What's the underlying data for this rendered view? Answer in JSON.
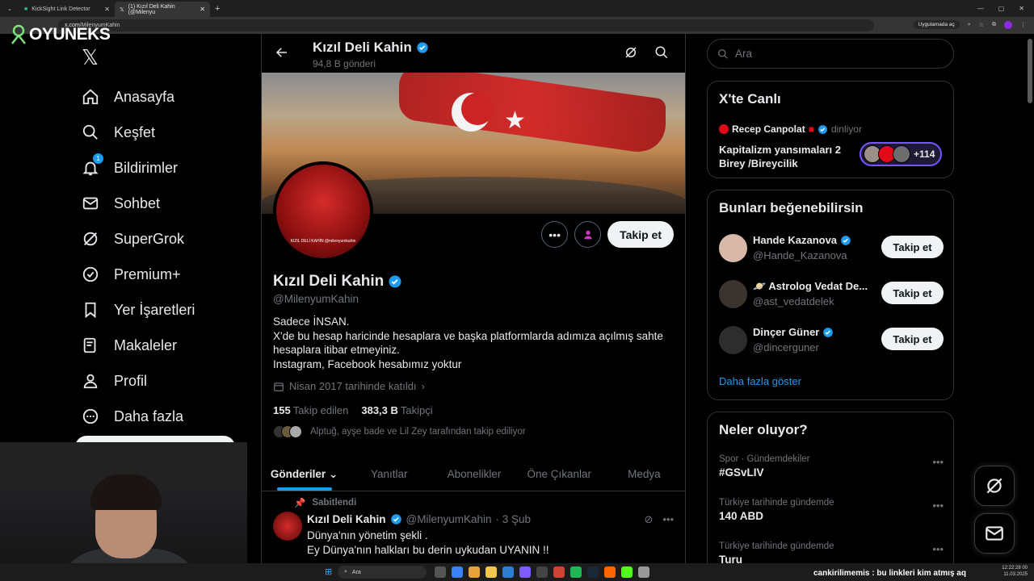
{
  "browser": {
    "tabs": [
      {
        "title": "KickSight Link Detector",
        "active": false
      },
      {
        "title": "(1) Kızıl Deli Kahin (@Milenyu",
        "active": true
      }
    ],
    "url_host": "x.com",
    "url_path": "/MilenyumKahin",
    "app_pill": "Uygulamada aç"
  },
  "overlay_logo": "OYUNEKS",
  "nav": {
    "items": [
      {
        "label": "Anasayfa",
        "icon": "home-icon"
      },
      {
        "label": "Keşfet",
        "icon": "search-icon"
      },
      {
        "label": "Bildirimler",
        "icon": "bell-icon",
        "badge": "1"
      },
      {
        "label": "Sohbet",
        "icon": "mail-icon"
      },
      {
        "label": "SuperGrok",
        "icon": "grok-icon"
      },
      {
        "label": "Premium+",
        "icon": "verified-icon"
      },
      {
        "label": "Yer İşaretleri",
        "icon": "bookmark-icon"
      },
      {
        "label": "Makaleler",
        "icon": "article-icon"
      },
      {
        "label": "Profil",
        "icon": "user-icon"
      },
      {
        "label": "Daha fazla",
        "icon": "more-circle-icon"
      }
    ]
  },
  "profile": {
    "header_name": "Kızıl Deli Kahin",
    "header_posts": "94,8 B gönderi",
    "avatar_text": "KIZIL DELİ KAHİN @milenyumkahin",
    "name": "Kızıl Deli Kahin",
    "handle": "@MilenyumKahin",
    "bio": [
      "Sadece İNSAN.",
      "X'de bu hesap haricinde hesaplara ve başka platformlarda adımıza açılmış sahte hesaplara itibar etmeyiniz.",
      "Instagram, Facebook hesabımız yoktur"
    ],
    "joined": "Nisan 2017 tarihinde katıldı",
    "following_count": "155",
    "following_label": "Takip edilen",
    "followers_count": "383,3 B",
    "followers_label": "Takipçi",
    "followed_by": "Alptuğ, ayşe bade ve Lil Zey tarafından takip ediliyor",
    "follow_button": "Takip et"
  },
  "tabs": [
    "Gönderiler",
    "Yanıtlar",
    "Abonelikler",
    "Öne Çıkanlar",
    "Medya"
  ],
  "pinned_tweet": {
    "pinned_label": "Sabitlendi",
    "name": "Kızıl Deli Kahin",
    "handle": "@MilenyumKahin",
    "date": "· 3 Şub",
    "lines": [
      "Dünya'nın yönetim şekli .",
      "Ey Dünya'nın halkları bu derin uykudan UYANIN !!"
    ]
  },
  "search_placeholder": "Ara",
  "live": {
    "title": "X'te Canlı",
    "host": "Recep Canpolat",
    "status": "dinliyor",
    "topic": "Kapitalizm yansımaları 2 Birey /Bireycilik",
    "listener_count": "+114"
  },
  "who_to_follow": {
    "title": "Bunları beğenebilirsin",
    "users": [
      {
        "name": "Hande Kazanova",
        "handle": "@Hande_Kazanova",
        "verified": true,
        "button": "Takip et"
      },
      {
        "name": "🪐 Astrolog Vedat De...",
        "handle": "@ast_vedatdelek",
        "verified": false,
        "button": "Takip et"
      },
      {
        "name": "Dinçer Güner",
        "handle": "@dincerguner",
        "verified": true,
        "button": "Takip et"
      }
    ],
    "show_more": "Daha fazla göster"
  },
  "trends": {
    "title": "Neler oluyor?",
    "items": [
      {
        "category": "Spor · Gündemdekiler",
        "topic": "#GSvLIV"
      },
      {
        "category": "Türkiye tarihinde gündemde",
        "topic": "140 ABD"
      },
      {
        "category": "Türkiye tarihinde gündemde",
        "topic": "Turu"
      }
    ]
  },
  "taskbar": {
    "search": "Ara",
    "chat_overlay": "cankirilimemis : bu linkleri kim atmış aq",
    "time": "12:22:28 00",
    "date": "11.03.2025"
  },
  "colors": {
    "accent": "#1d9bf0",
    "background": "#000000",
    "border": "#2f3336",
    "muted_text": "#71767b",
    "live_purple": "#7856ff"
  }
}
